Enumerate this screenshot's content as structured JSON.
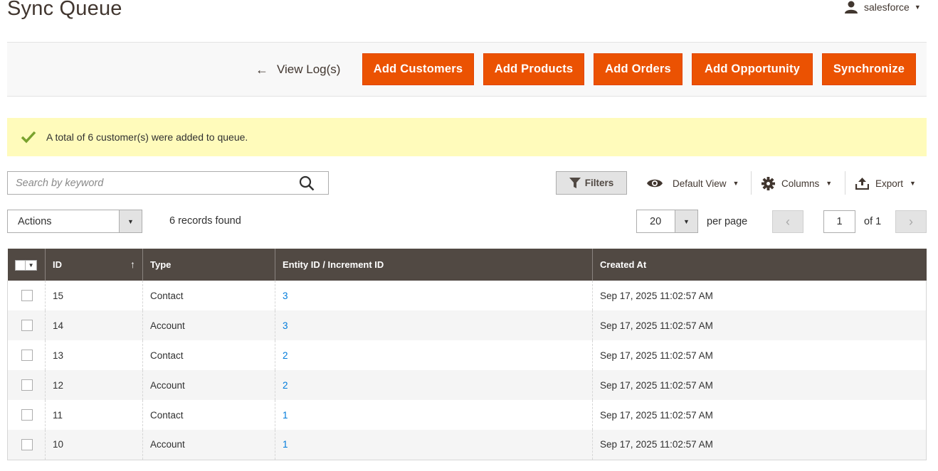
{
  "page": {
    "title": "Sync Queue"
  },
  "header": {
    "user_name": "salesforce"
  },
  "actions_bar": {
    "back_label": "View Log(s)",
    "buttons": [
      "Add Customers",
      "Add Products",
      "Add Orders",
      "Add Opportunity",
      "Synchronize"
    ]
  },
  "message": {
    "text": "A total of 6 customer(s) were added to queue."
  },
  "toolbar": {
    "search_placeholder": "Search by keyword",
    "filters_label": "Filters",
    "view_label": "Default View",
    "columns_label": "Columns",
    "export_label": "Export",
    "actions_label": "Actions",
    "records_found": "6 records found",
    "per_page_value": "20",
    "per_page_label": "per page",
    "current_page": "1",
    "total_pages_label": "of 1"
  },
  "colors": {
    "accent": "#eb5202",
    "header_bg": "#514943",
    "success_bg": "#fffbbb",
    "link": "#007bdb"
  },
  "grid": {
    "columns": [
      "ID",
      "Type",
      "Entity ID / Increment ID",
      "Created At"
    ],
    "rows": [
      {
        "id": "15",
        "type": "Contact",
        "entity": "3",
        "created": "Sep 17, 2025 11:02:57 AM"
      },
      {
        "id": "14",
        "type": "Account",
        "entity": "3",
        "created": "Sep 17, 2025 11:02:57 AM"
      },
      {
        "id": "13",
        "type": "Contact",
        "entity": "2",
        "created": "Sep 17, 2025 11:02:57 AM"
      },
      {
        "id": "12",
        "type": "Account",
        "entity": "2",
        "created": "Sep 17, 2025 11:02:57 AM"
      },
      {
        "id": "11",
        "type": "Contact",
        "entity": "1",
        "created": "Sep 17, 2025 11:02:57 AM"
      },
      {
        "id": "10",
        "type": "Account",
        "entity": "1",
        "created": "Sep 17, 2025 11:02:57 AM"
      }
    ]
  }
}
